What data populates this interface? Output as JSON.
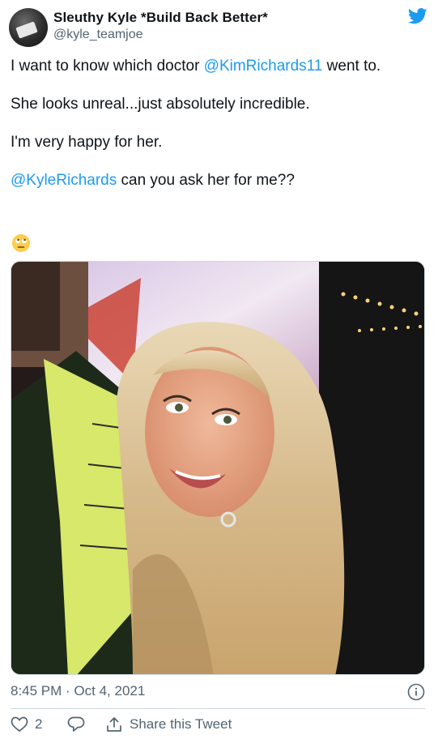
{
  "tweet": {
    "author_name": "Sleuthy Kyle *Build Back Better*",
    "author_handle": "@kyle_teamjoe",
    "line1_pre": "I want to know which doctor ",
    "mention1": "@KimRichards11",
    "line1_post": " went to.",
    "paragraph2": "She looks unreal...just absolutely incredible.",
    "paragraph3": "I'm very happy for her.",
    "mention2": "@KyleRichards",
    "paragraph4_post": " can you ask her for me??",
    "emoji": "rolling-eyes-face",
    "timestamp": "8:45 PM · Oct 4, 2021",
    "like_count": "2",
    "share_label": "Share this Tweet"
  },
  "icons": {
    "brand": "twitter-bird-icon",
    "info": "info-icon",
    "like": "heart-icon",
    "reply": "reply-icon",
    "share": "share-icon"
  },
  "colors": {
    "link": "#1d9bf0",
    "secondary_text": "#536471",
    "border": "#cfd9de"
  }
}
